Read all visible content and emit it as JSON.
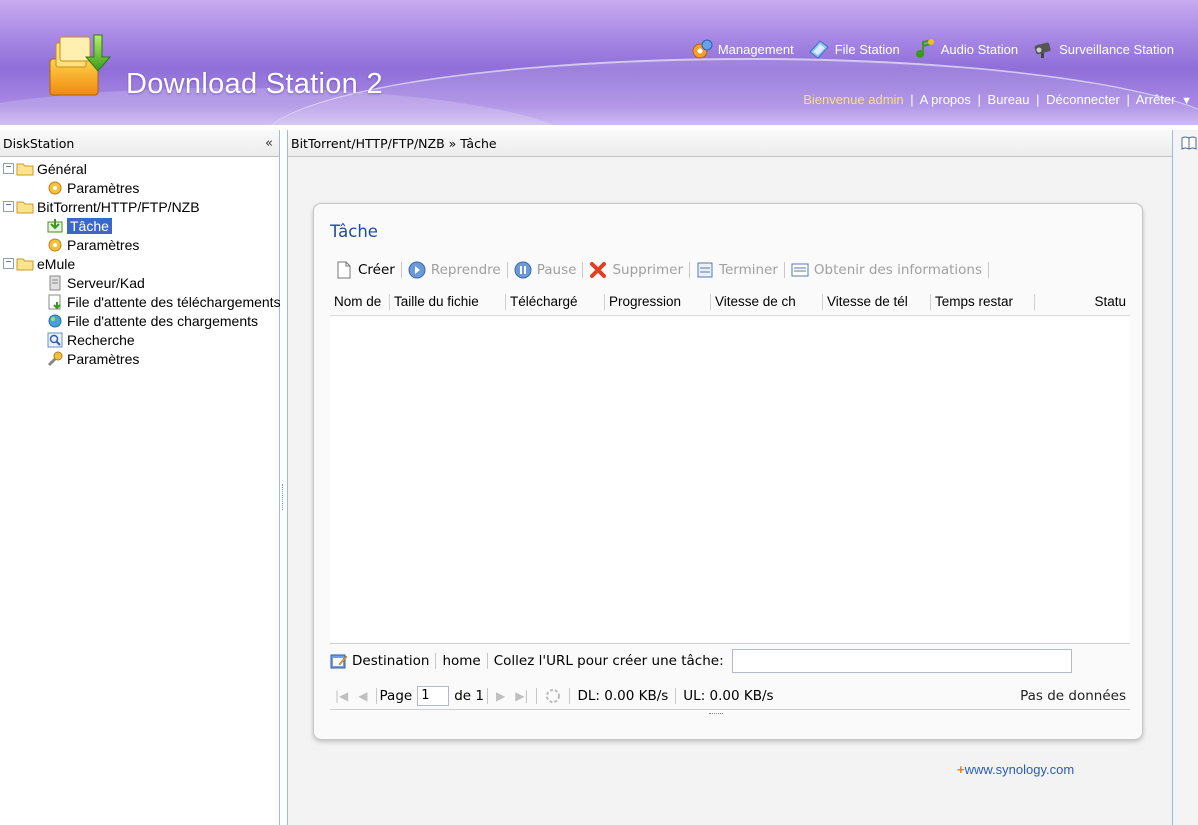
{
  "header": {
    "app_title": "Download Station 2",
    "nav": [
      {
        "label": "Management",
        "icon": "management-icon"
      },
      {
        "label": "File Station",
        "icon": "file-station-icon"
      },
      {
        "label": "Audio Station",
        "icon": "audio-station-icon"
      },
      {
        "label": "Surveillance Station",
        "icon": "surveillance-station-icon"
      }
    ],
    "user_links": {
      "welcome": "Bienvenue admin",
      "about": "A propos",
      "desktop": "Bureau",
      "logout": "Déconnecter",
      "shutdown": "Arrêter",
      "separator": "|",
      "arrow": "▼"
    }
  },
  "left_panel": {
    "title": "DiskStation",
    "collapse": "«",
    "tree": [
      {
        "label": "Général",
        "toggle": "−"
      },
      {
        "label": "Paramètres"
      },
      {
        "label": "BitTorrent/HTTP/FTP/NZB",
        "toggle": "−"
      },
      {
        "label": "Tâche",
        "selected": true
      },
      {
        "label": "Paramètres"
      },
      {
        "label": "eMule",
        "toggle": "−"
      },
      {
        "label": "Serveur/Kad"
      },
      {
        "label": "File d'attente des téléchargements"
      },
      {
        "label": "File d'attente des chargements"
      },
      {
        "label": "Recherche"
      },
      {
        "label": "Paramètres"
      }
    ]
  },
  "breadcrumb": "BitTorrent/HTTP/FTP/NZB » Tâche",
  "task_panel": {
    "title": "Tâche",
    "toolbar": {
      "create": "Créer",
      "resume": "Reprendre",
      "pause": "Pause",
      "delete": "Supprimer",
      "finish": "Terminer",
      "info": "Obtenir des informations"
    },
    "columns": [
      "Nom de",
      "Taille du fichie",
      "Téléchargé",
      "Progression",
      "Vitesse de ch",
      "Vitesse de tél",
      "Temps restar",
      "Statu"
    ],
    "destination_label": "Destination",
    "destination_value": "home",
    "paste_url_label": "Collez l'URL pour créer une tâche:",
    "url_value": "",
    "pager": {
      "page_label": "Page",
      "page_value": "1",
      "of_label": "de 1",
      "dl": "DL: 0.00 KB/s",
      "ul": "UL: 0.00 KB/s",
      "no_data": "Pas de données"
    }
  },
  "footer_link": "www.synology.com",
  "footer_plus": "+",
  "colors": {
    "header_purple": "#9c7de0",
    "welcome_yellow": "#f6e27a",
    "title_blue": "#1e4b9b",
    "selection_blue": "#3a67c8",
    "link_blue": "#2b5cb8"
  }
}
